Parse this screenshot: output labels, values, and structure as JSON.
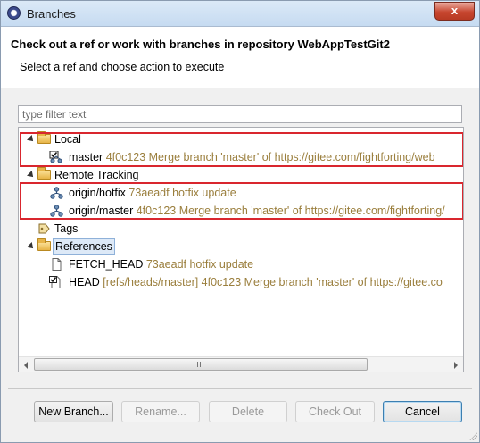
{
  "window": {
    "title": "Branches",
    "close_label": "x"
  },
  "header": {
    "title": "Check out a ref or work with branches in repository WebAppTestGit2",
    "subtitle": "Select a ref and choose action to execute"
  },
  "filter": {
    "placeholder": "type filter text",
    "value": ""
  },
  "tree": {
    "local": {
      "label": "Local"
    },
    "master": {
      "name": "master",
      "commit": "4f0c123 Merge branch 'master' of https://gitee.com/fightforting/web"
    },
    "remote": {
      "label": "Remote Tracking"
    },
    "origin_hotfix": {
      "name": "origin/hotfix",
      "commit": "73aeadf hotfix update"
    },
    "origin_master": {
      "name": "origin/master",
      "commit": "4f0c123 Merge branch 'master' of https://gitee.com/fightforting/"
    },
    "tags": {
      "label": "Tags"
    },
    "references": {
      "label": "References"
    },
    "fetch_head": {
      "name": "FETCH_HEAD",
      "commit": "73aeadf hotfix update"
    },
    "head": {
      "name": "HEAD",
      "commit": "[refs/heads/master] 4f0c123 Merge branch 'master' of https://gitee.co"
    }
  },
  "buttons": {
    "new_branch": "New Branch...",
    "rename": "Rename...",
    "delete": "Delete",
    "check_out": "Check Out",
    "cancel": "Cancel"
  },
  "colors": {
    "highlight_box": "#d9262e",
    "commit_text": "#9a7e3c"
  }
}
